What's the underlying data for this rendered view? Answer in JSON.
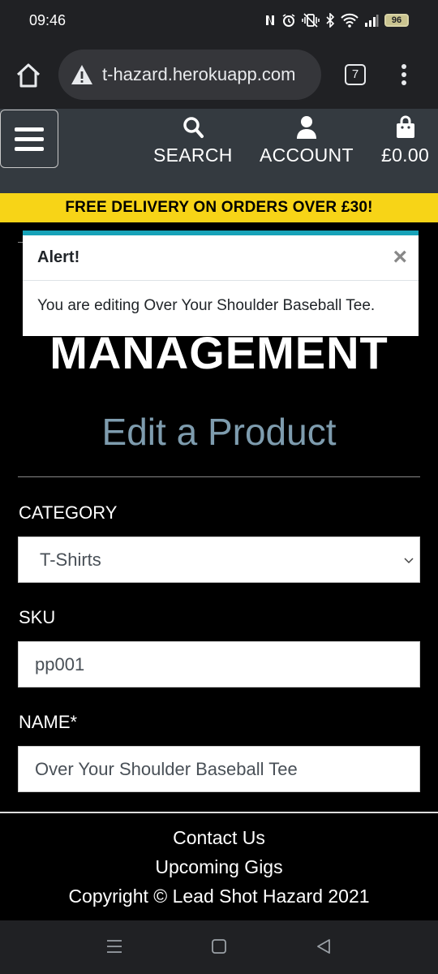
{
  "status_bar": {
    "time": "09:46",
    "battery": "96"
  },
  "browser": {
    "url": "t-hazard.herokuapp.com",
    "tab_count": "7"
  },
  "header": {
    "search_label": "SEARCH",
    "account_label": "ACCOUNT",
    "cart_total": "£0.00"
  },
  "banner": {
    "text": "FREE DELIVERY ON ORDERS OVER £30!"
  },
  "alert": {
    "title": "Alert!",
    "close": "×",
    "message": "You are editing Over Your Shoulder Baseball Tee."
  },
  "main": {
    "title": "MANAGEMENT",
    "subtitle": "Edit a Product"
  },
  "form": {
    "category_label": "CATEGORY",
    "category_value": "T-Shirts",
    "sku_label": "SKU",
    "sku_value": "pp001",
    "name_label": "NAME*",
    "name_value": "Over Your Shoulder Baseball Tee"
  },
  "footer": {
    "contact": "Contact Us",
    "gigs": "Upcoming Gigs",
    "copyright": "Copyright © Lead Shot Hazard 2021"
  },
  "colors": {
    "banner": "#f7d417",
    "header": "#343a40",
    "subtitle": "#7e9cae",
    "alert_accent": "#17a2b8"
  }
}
